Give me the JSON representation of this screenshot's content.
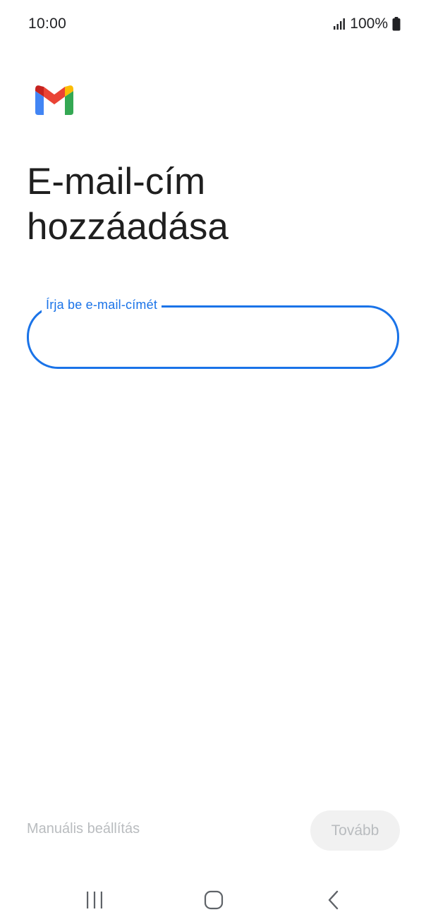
{
  "status_bar": {
    "time": "10:00",
    "battery_text": "100%",
    "signal_icon": "signal-icon",
    "battery_icon": "battery-icon"
  },
  "logo": {
    "icon": "gmail-logo-icon"
  },
  "page": {
    "title": "E-mail-cím hozzáadása"
  },
  "email_field": {
    "label": "Írja be e-mail-címét",
    "value": "",
    "border_color": "#1a73e8"
  },
  "footer": {
    "manual_setup_label": "Manuális beállítás",
    "next_label": "Tovább",
    "disabled_text_color": "#b9bcbf"
  },
  "nav_bar": {
    "recents_icon": "recents-icon",
    "home_icon": "home-icon",
    "back_icon": "back-icon"
  }
}
